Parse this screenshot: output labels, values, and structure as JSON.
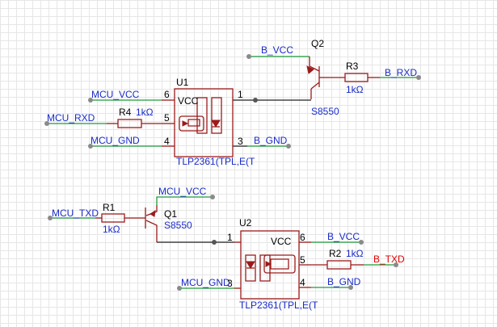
{
  "nets": {
    "b_vcc_top": "B_VCC",
    "b_rxd": "B_RXD",
    "mcu_vcc_top": "MCU_VCC",
    "mcu_rxd": "MCU_RXD",
    "mcu_gnd_top": "MCU_GND",
    "b_gnd_top": "B_GND",
    "mcu_vcc_bottom": "MCU_VCC",
    "mcu_txd": "MCU_TXD",
    "b_vcc_bottom": "B_VCC",
    "b_txd": "B_TXD",
    "mcu_gnd_bottom": "MCU_GND",
    "b_gnd_bottom": "B_GND"
  },
  "components": {
    "q2": {
      "ref": "Q2",
      "value": "S8550"
    },
    "q1": {
      "ref": "Q1",
      "value": "S8550"
    },
    "r3": {
      "ref": "R3",
      "value": "1kΩ"
    },
    "r4": {
      "ref": "R4",
      "value": "1kΩ"
    },
    "r1": {
      "ref": "R1",
      "value": "1kΩ"
    },
    "r2": {
      "ref": "R2",
      "value": "1kΩ"
    },
    "u1": {
      "ref": "U1",
      "part": "TLP2361(TPL,E(T",
      "vcc": "VCC",
      "pins": [
        "6",
        "5",
        "4",
        "1",
        "3"
      ]
    },
    "u2": {
      "ref": "U2",
      "part": "TLP2361(TPL,E(T",
      "vcc": "VCC",
      "pins": [
        "1",
        "3",
        "6",
        "5",
        "4"
      ]
    }
  },
  "colors": {
    "wire": "#1f9a3a",
    "component": "#9b1b1b",
    "net_label": "#1a2cc8",
    "highlight_net": "#e00000"
  }
}
